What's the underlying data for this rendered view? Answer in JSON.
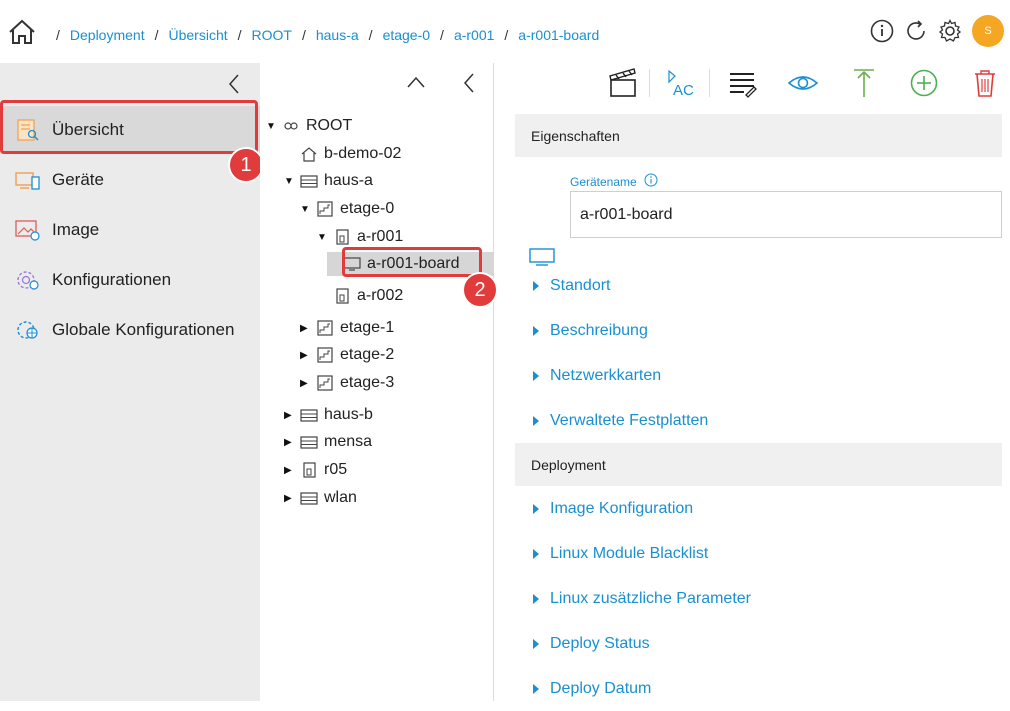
{
  "breadcrumb": [
    "Deployment",
    "Übersicht",
    "ROOT",
    "haus-a",
    "etage-0",
    "a-r001",
    "a-r001-board"
  ],
  "avatar_initial": "S",
  "sidebar": {
    "items": [
      {
        "label": "Übersicht",
        "icon": "overview-icon"
      },
      {
        "label": "Geräte",
        "icon": "devices-icon"
      },
      {
        "label": "Image",
        "icon": "image-icon"
      },
      {
        "label": "Konfigurationen",
        "icon": "config-icon"
      },
      {
        "label": "Globale Konfigurationen",
        "icon": "global-config-icon"
      }
    ]
  },
  "annotations": [
    "1",
    "2"
  ],
  "tree": [
    {
      "label": "ROOT",
      "icon": "root-icon",
      "caret": "▼"
    },
    {
      "label": "b-demo-02",
      "icon": "house-icon",
      "caret": ""
    },
    {
      "label": "haus-a",
      "icon": "building-icon",
      "caret": "▼"
    },
    {
      "label": "etage-0",
      "icon": "floor-icon",
      "caret": "▼"
    },
    {
      "label": "a-r001",
      "icon": "room-icon",
      "caret": "▼"
    },
    {
      "label": "a-r001-board",
      "icon": "monitor-icon",
      "caret": ""
    },
    {
      "label": "a-r002",
      "icon": "room-icon",
      "caret": ""
    },
    {
      "label": "etage-1",
      "icon": "floor-icon",
      "caret": "▶"
    },
    {
      "label": "etage-2",
      "icon": "floor-icon",
      "caret": "▶"
    },
    {
      "label": "etage-3",
      "icon": "floor-icon",
      "caret": "▶"
    },
    {
      "label": "haus-b",
      "icon": "building-icon",
      "caret": "▶"
    },
    {
      "label": "mensa",
      "icon": "building-icon",
      "caret": "▶"
    },
    {
      "label": "r05",
      "icon": "room-icon",
      "caret": "▶"
    },
    {
      "label": "wlan",
      "icon": "building-icon",
      "caret": "▶"
    }
  ],
  "details": {
    "eigenschaften_title": "Eigenschaften",
    "geraetename_label": "Gerätename",
    "geraetename_value": "a-r001-board",
    "properties": [
      "Standort",
      "Beschreibung",
      "Netzwerkkarten",
      "Verwaltete Festplatten"
    ],
    "deployment_title": "Deployment",
    "deployment_items": [
      "Image Konfiguration",
      "Linux Module Blacklist",
      "Linux zusätzliche Parameter",
      "Deploy Status",
      "Deploy Datum"
    ]
  },
  "colors": {
    "accent": "#1a8fd1",
    "highlight": "#e23b3b",
    "avatar": "#f5a623",
    "add": "#4caf50",
    "delete": "#e23b3b",
    "up": "#6ab04c"
  }
}
